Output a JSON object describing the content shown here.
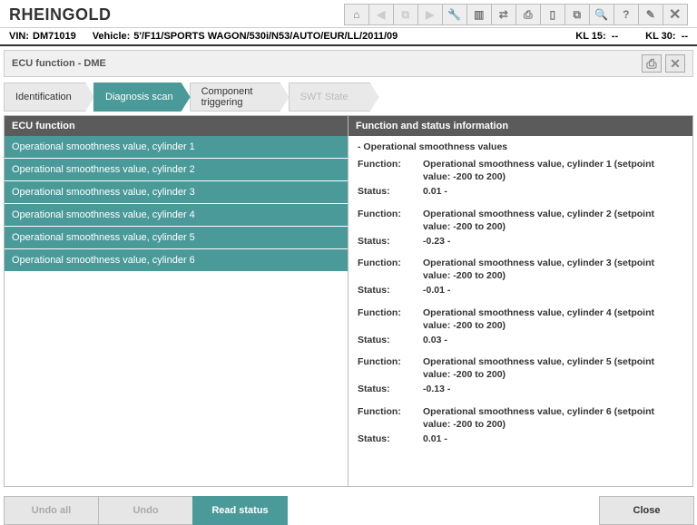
{
  "app": {
    "title": "RHEINGOLD"
  },
  "info": {
    "vin_label": "VIN:",
    "vin": "DM71019",
    "vehicle_label": "Vehicle:",
    "vehicle": "5'/F11/SPORTS WAGON/530i/N53/AUTO/EUR/LL/2011/09",
    "kl15_label": "KL 15:",
    "kl15": "--",
    "kl30_label": "KL 30:",
    "kl30": "--"
  },
  "subheader": {
    "title": "ECU function - DME"
  },
  "tabs": [
    {
      "label": "Identification",
      "active": false
    },
    {
      "label": "Diagnosis scan",
      "active": true
    },
    {
      "label": "Component triggering",
      "active": false
    },
    {
      "label": "SWT State",
      "active": false,
      "disabled": true
    }
  ],
  "left": {
    "header": "ECU function",
    "items": [
      "Operational smoothness value, cylinder 1",
      "Operational smoothness value, cylinder 2",
      "Operational smoothness value, cylinder 3",
      "Operational smoothness value, cylinder 4",
      "Operational smoothness value, cylinder 5",
      "Operational smoothness value, cylinder 6"
    ]
  },
  "right": {
    "header": "Function and status information",
    "section_title": "- Operational smoothness values",
    "function_label": "Function:",
    "status_label": "Status:",
    "entries": [
      {
        "func": "Operational smoothness value, cylinder 1 (setpoint value: -200 to 200)",
        "status": "0.01  -"
      },
      {
        "func": "Operational smoothness value, cylinder 2 (setpoint value: -200 to 200)",
        "status": "-0.23  -"
      },
      {
        "func": "Operational smoothness value, cylinder 3 (setpoint value: -200 to 200)",
        "status": "-0.01  -"
      },
      {
        "func": "Operational smoothness value, cylinder 4 (setpoint value: -200 to 200)",
        "status": "0.03  -"
      },
      {
        "func": "Operational smoothness value, cylinder 5 (setpoint value: -200 to 200)",
        "status": "-0.13  -"
      },
      {
        "func": "Operational smoothness value, cylinder 6 (setpoint value: -200 to 200)",
        "status": "0.01  -"
      }
    ]
  },
  "footer": {
    "undo_all": "Undo all",
    "undo": "Undo",
    "read_status": "Read status",
    "close": "Close"
  },
  "toolbar_icons": [
    "⌂",
    "◀",
    "⧉",
    "▶",
    "🔧",
    "▥",
    "⇄",
    "⎙",
    "▯",
    "⧉",
    "🔍",
    "?",
    "✎",
    "✕"
  ]
}
